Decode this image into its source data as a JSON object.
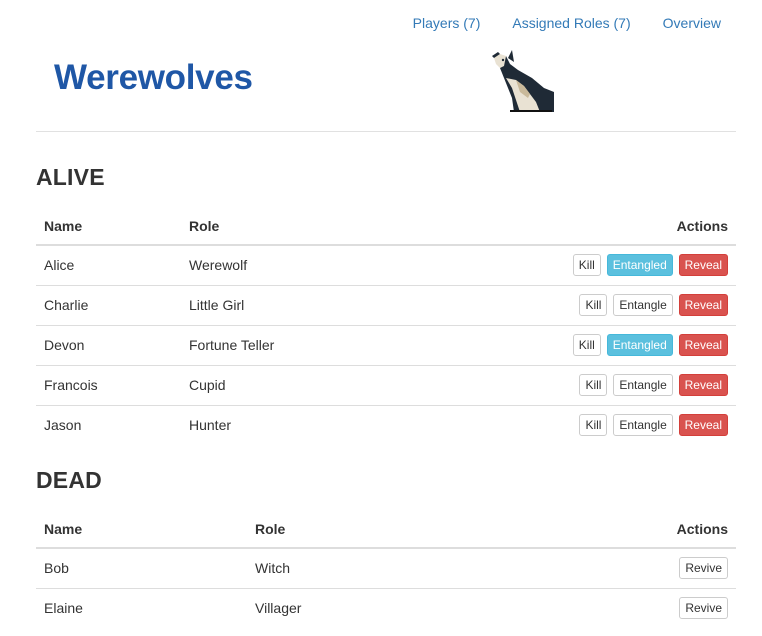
{
  "nav": {
    "players": "Players (7)",
    "assigned_roles": "Assigned Roles (7)",
    "overview": "Overview"
  },
  "brand": {
    "title": "Werewolves",
    "logo_icon": "howling-wolf-icon"
  },
  "colors": {
    "brand": "#1f57a6",
    "link": "#337ab7",
    "info": "#5bc0de",
    "danger": "#d9534f"
  },
  "alive": {
    "title": "ALIVE",
    "headers": {
      "name": "Name",
      "role": "Role",
      "actions": "Actions"
    },
    "rows": [
      {
        "name": "Alice",
        "role": "Werewolf",
        "kill": "Kill",
        "entangle": "Entangled",
        "reveal": "Reveal"
      },
      {
        "name": "Charlie",
        "role": "Little Girl",
        "kill": "Kill",
        "entangle": "Entangle",
        "reveal": "Reveal"
      },
      {
        "name": "Devon",
        "role": "Fortune Teller",
        "kill": "Kill",
        "entangle": "Entangled",
        "reveal": "Reveal"
      },
      {
        "name": "Francois",
        "role": "Cupid",
        "kill": "Kill",
        "entangle": "Entangle",
        "reveal": "Reveal"
      },
      {
        "name": "Jason",
        "role": "Hunter",
        "kill": "Kill",
        "entangle": "Entangle",
        "reveal": "Reveal"
      }
    ]
  },
  "dead": {
    "title": "DEAD",
    "headers": {
      "name": "Name",
      "role": "Role",
      "actions": "Actions"
    },
    "rows": [
      {
        "name": "Bob",
        "role": "Witch",
        "revive": "Revive"
      },
      {
        "name": "Elaine",
        "role": "Villager",
        "revive": "Revive"
      }
    ]
  }
}
